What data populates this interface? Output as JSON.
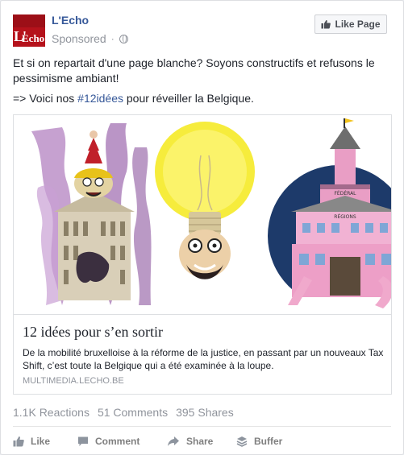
{
  "header": {
    "page_name": "L'Echo",
    "sponsored": "Sponsored",
    "separator": "·",
    "logo_text_l": "L'",
    "logo_text_echo": "Echo",
    "like_page_label": "Like Page"
  },
  "post": {
    "line1": "Et si on repartait d'une page blanche? Soyons constructifs et refusons le pessimisme ambiant!",
    "line2_prefix": "=> Voici nos ",
    "hashtag": "#12idées",
    "line2_suffix": " pour réveiller la Belgique."
  },
  "card": {
    "title": "12 idées pour s’en sortir",
    "description": "De la mobilité bruxelloise à la réforme de la justice, en passant par un nouveaux Tax Shift, c’est toute la Belgique qui a été examinée à la loupe.",
    "domain": "MULTIMEDIA.LECHO.BE",
    "sign_federal": "FÉDÉRAL",
    "sign_regions": "RÉGIONS"
  },
  "stats": {
    "reactions": "1.1K Reactions",
    "comments": "51 Comments",
    "shares": "395 Shares"
  },
  "actions": {
    "like": "Like",
    "comment": "Comment",
    "share": "Share",
    "buffer": "Buffer"
  },
  "colors": {
    "link_blue": "#365899",
    "brand_red": "#b5121b",
    "muted_gray": "#90949c"
  }
}
